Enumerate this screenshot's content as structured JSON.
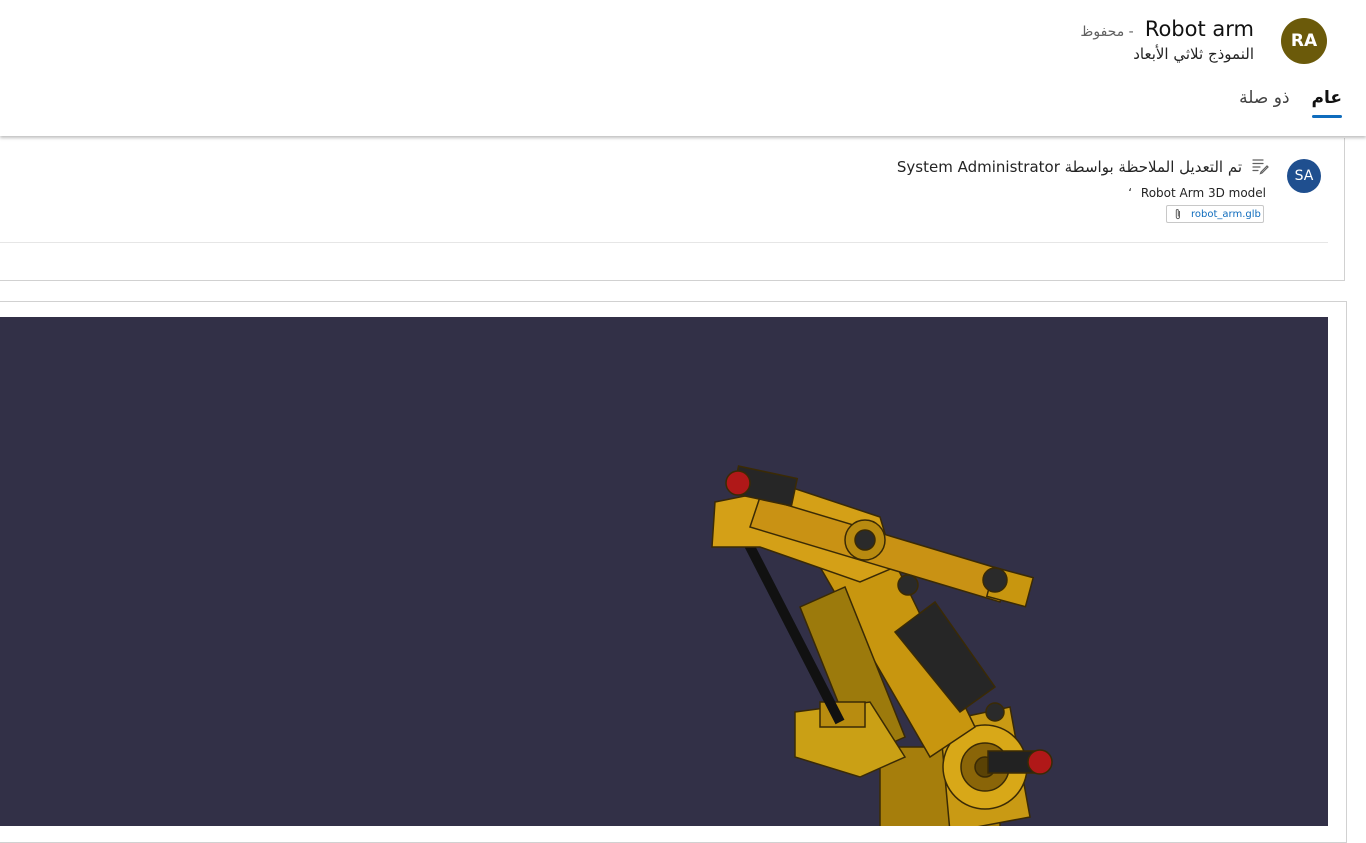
{
  "header": {
    "avatar_initials": "RA",
    "avatar_color": "#6b5a0a",
    "record_title": "Robot arm",
    "saved_status": "- محفوظ",
    "entity_type": "النموذج ثلاثي الأبعاد",
    "tabs": [
      {
        "label": "عام",
        "active": true
      },
      {
        "label": "ذو صلة",
        "active": false
      }
    ]
  },
  "timeline": {
    "note": {
      "author_initials": "SA",
      "author_avatar_color": "#1f4f8f",
      "icon": "note-edit-icon",
      "title": "تم التعديل الملاحظة بواسطة System Administrator",
      "text": "Robot Arm 3D model",
      "extra_mark": "،",
      "attachment": {
        "icon": "paperclip-icon",
        "filename": "robot_arm.glb"
      }
    }
  },
  "viewer": {
    "background_color": "#323047",
    "model_color": "#d4a017"
  }
}
